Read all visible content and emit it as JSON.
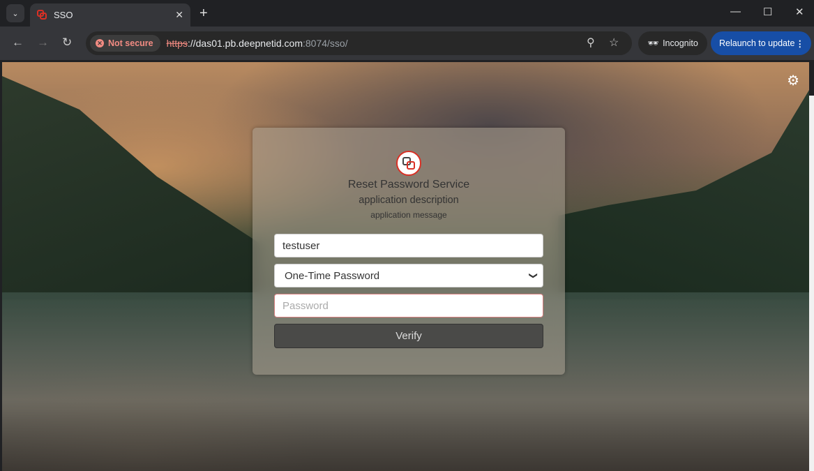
{
  "browser": {
    "tab_title": "SSO",
    "security_chip": "Not secure",
    "url_scheme": "https",
    "url_host": "://das01.pb.deepnetid.com",
    "url_rest": ":8074/sso/",
    "incognito_label": "Incognito",
    "relaunch_label": "Relaunch to update"
  },
  "form": {
    "title": "Reset Password Service",
    "description": "application description",
    "message": "application message",
    "username_value": "testuser",
    "method_selected": "One-Time Password",
    "password_placeholder": "Password",
    "verify_label": "Verify"
  }
}
